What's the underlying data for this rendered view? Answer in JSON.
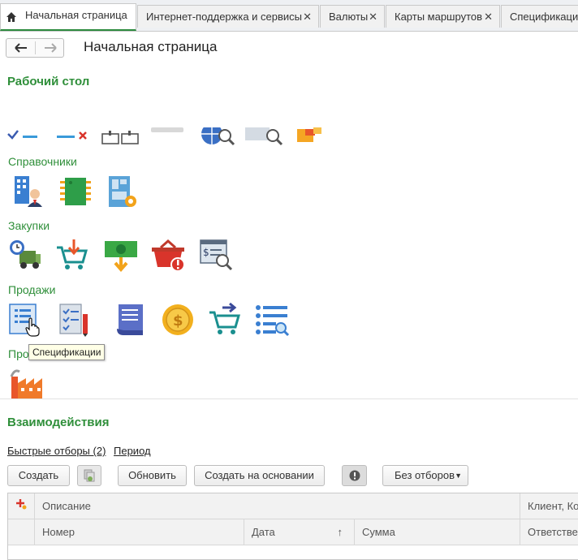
{
  "tabs": [
    {
      "label": "Начальная страница",
      "active": true
    },
    {
      "label": "Интернет-поддержка и сервисы"
    },
    {
      "label": "Валюты"
    },
    {
      "label": "Карты маршрутов"
    },
    {
      "label": "Спецификации"
    }
  ],
  "nav": {
    "back": "←",
    "forward": "→"
  },
  "page_title": "Начальная страница",
  "desktop": {
    "title": "Рабочий стол"
  },
  "groups": {
    "catalogs": "Справочники",
    "purchases": "Закупки",
    "sales": "Продажи",
    "production": "Про"
  },
  "tooltip": "Спецификации",
  "interactions": {
    "title": "Взаимодействия",
    "quick_filters": "Быстрые отборы (2)",
    "period": "Период",
    "create": "Создать",
    "refresh": "Обновить",
    "create_based": "Создать на основании",
    "no_filters": "Без отборов",
    "columns_row1": [
      "Описание",
      "Клиент, Ко"
    ],
    "columns_row2": [
      "Номер",
      "Дата",
      "Сумма",
      "Ответствен"
    ],
    "sort_indicator": "↑"
  },
  "colors": {
    "accent_green": "#2f8f3a",
    "tab_underline": "#2b8a3e"
  }
}
